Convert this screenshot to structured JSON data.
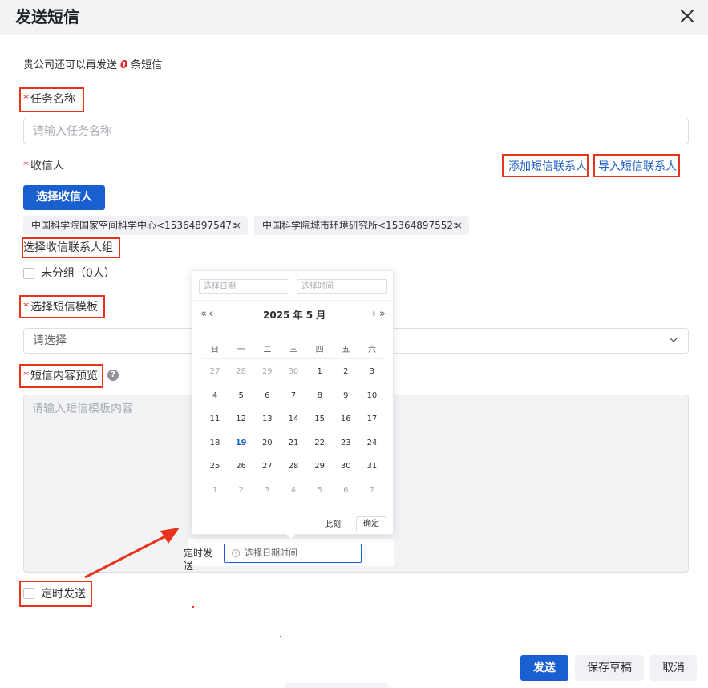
{
  "dialog": {
    "title": "发送短信"
  },
  "quota": {
    "prefix": "贵公司还可以再发送",
    "count": "0",
    "suffix": "条短信"
  },
  "task_name": {
    "required_mark": "*",
    "label": "任务名称",
    "placeholder": "请输入任务名称"
  },
  "recipient": {
    "required_mark": "*",
    "label": "收信人",
    "add_contact_link": "添加短信联系人",
    "import_contact_link": "导入短信联系人",
    "select_button": "选择收信人",
    "tags": [
      {
        "label": "中国科学院国家空间科学中心<15364897547>",
        "remove": "×"
      },
      {
        "label": "中国科学院城市环境研究所<15364897552>",
        "remove": "×"
      }
    ]
  },
  "contact_group": {
    "label": "选择收信联系人组",
    "groups": [
      {
        "label": "未分组（0人）"
      }
    ]
  },
  "template": {
    "required_mark": "*",
    "label": "选择短信模板",
    "placeholder": "请选择"
  },
  "preview": {
    "required_mark": "*",
    "label": "短信内容预览",
    "help_icon": "?",
    "placeholder": "请输入短信模板内容"
  },
  "schedule": {
    "checkbox_label": "定时发送",
    "inline_label": "定时发送",
    "datetime_placeholder": "选择日期时间"
  },
  "date_picker": {
    "date_placeholder": "选择日期",
    "time_placeholder": "选择时间",
    "prev_year": "«",
    "prev_month": "‹",
    "next_month": "›",
    "next_year": "»",
    "header": "2025 年  5 月",
    "weekdays": [
      "日",
      "一",
      "二",
      "三",
      "四",
      "五",
      "六"
    ],
    "weeks": [
      [
        "27",
        "28",
        "29",
        "30",
        "1",
        "2",
        "3"
      ],
      [
        "4",
        "5",
        "6",
        "7",
        "8",
        "9",
        "10"
      ],
      [
        "11",
        "12",
        "13",
        "14",
        "15",
        "16",
        "17"
      ],
      [
        "18",
        "19",
        "20",
        "21",
        "22",
        "23",
        "24"
      ],
      [
        "25",
        "26",
        "27",
        "28",
        "29",
        "30",
        "31"
      ],
      [
        "1",
        "2",
        "3",
        "4",
        "5",
        "6",
        "7"
      ]
    ],
    "today": "19",
    "now_button": "此刻",
    "confirm_button": "确定"
  },
  "footer": {
    "send_button": "发送",
    "save_draft_button": "保存草稿",
    "cancel_button": "取消"
  },
  "colors": {
    "primary": "#1a5fd0",
    "danger": "#e02020",
    "annotation": "#e8341c"
  }
}
